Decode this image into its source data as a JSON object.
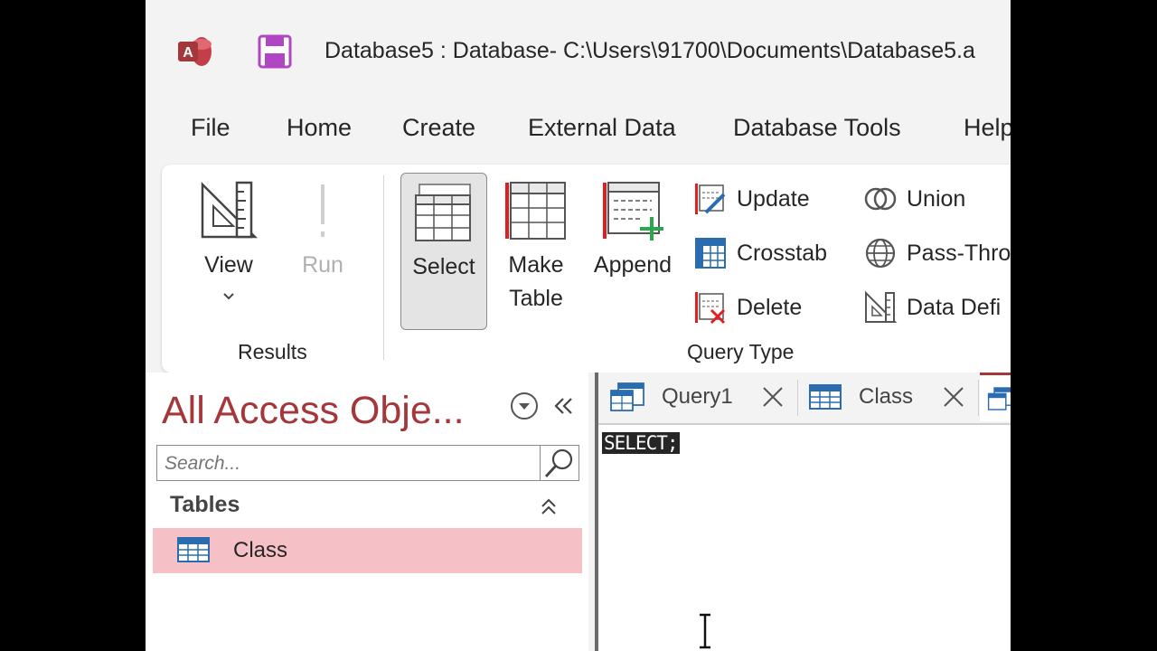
{
  "window": {
    "title": "Database5 : Database- C:\\Users\\91700\\Documents\\Database5.a",
    "app_logo_letter": "A"
  },
  "menu": {
    "tabs": [
      "File",
      "Home",
      "Create",
      "External Data",
      "Database Tools",
      "Help"
    ]
  },
  "ribbon": {
    "results": {
      "view_label": "View",
      "run_label": "Run",
      "group_label": "Results"
    },
    "query_type": {
      "select_label": "Select",
      "make_table_line1": "Make",
      "make_table_line2": "Table",
      "append_label": "Append",
      "update_label": "Update",
      "crosstab_label": "Crosstab",
      "delete_label": "Delete",
      "union_label": "Union",
      "pass_through_label": "Pass-Thro",
      "data_definition_label": "Data Defi",
      "group_label": "Query Type"
    }
  },
  "nav_pane": {
    "title": "All Access Obje...",
    "search_placeholder": "Search...",
    "group_header": "Tables",
    "items": [
      "Class"
    ]
  },
  "doc_tabs": [
    {
      "label": "Query1"
    },
    {
      "label": "Class"
    }
  ],
  "editor": {
    "sql_text": "SELECT;"
  },
  "colors": {
    "access_red": "#a4373a",
    "selected_item": "#f6c0c7",
    "save_icon_purple": "#b146c2",
    "grid_blue": "#2b6cb0"
  }
}
